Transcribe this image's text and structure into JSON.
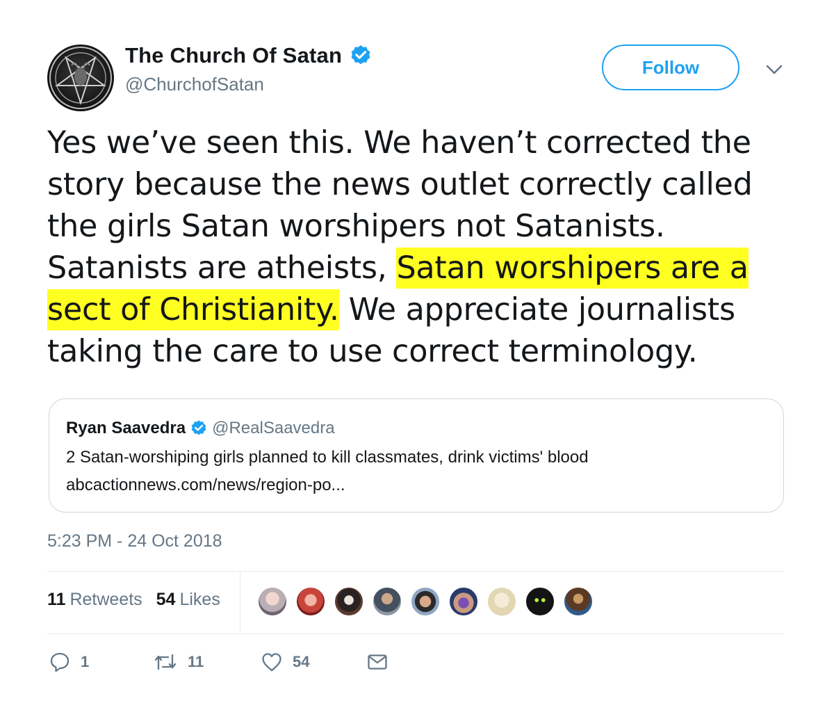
{
  "author": {
    "display_name": "The Church Of Satan",
    "handle": "@ChurchofSatan",
    "verified": true
  },
  "follow_button": {
    "label": "Follow"
  },
  "tweet": {
    "text_before_highlight": "Yes we’ve seen this. We haven’t corrected the story because the news outlet correctly called the girls Satan worshipers not Satanists. Satanists are atheists, ",
    "highlighted_text": "Satan worshipers are a sect of Christianity.",
    "text_after_highlight": " We appreciate journalists taking the care to use correct terminology.",
    "highlight_color": "#ffff22"
  },
  "quoted_tweet": {
    "display_name": "Ryan Saavedra",
    "handle": "@RealSaavedra",
    "verified": true,
    "text": "2 Satan-worshiping girls planned to kill classmates, drink victims' blood",
    "link": "abcactionnews.com/news/region-po..."
  },
  "timestamp": "5:23 PM - 24 Oct 2018",
  "stats": {
    "retweets_count": "11",
    "retweets_label": "Retweets",
    "likes_count": "54",
    "likes_label": "Likes"
  },
  "liked_by_avatars": [
    "avatar-1",
    "avatar-2",
    "avatar-3",
    "avatar-4",
    "avatar-5",
    "avatar-6",
    "avatar-7",
    "avatar-8",
    "avatar-9"
  ],
  "actions": {
    "reply_count": "1",
    "retweet_count": "11",
    "like_count": "54"
  },
  "colors": {
    "accent": "#1da1f2",
    "secondary_text": "#657786",
    "border": "#ccd6dd"
  }
}
